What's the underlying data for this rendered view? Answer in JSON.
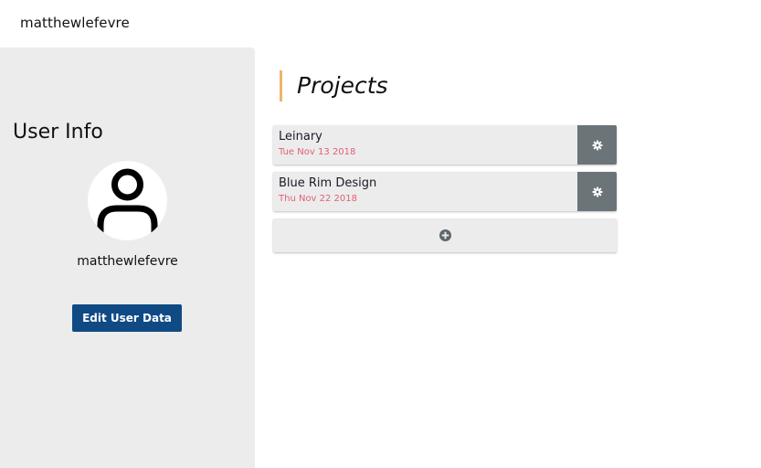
{
  "header": {
    "brand": "matthewlefevre"
  },
  "sidebar": {
    "title": "User Info",
    "avatar_icon": "user-avatar-icon",
    "username": "matthewlefevre",
    "edit_button_label": "Edit User Data"
  },
  "main": {
    "heading": "Projects",
    "projects": [
      {
        "name": "Leinary",
        "date": "Tue Nov 13 2018",
        "action_icon": "gear-icon"
      },
      {
        "name": "Blue Rim Design",
        "date": "Thu Nov 22 2018",
        "action_icon": "gear-icon"
      }
    ],
    "add_icon": "plus-circle-icon"
  },
  "colors": {
    "sidebar_bg": "#ececec",
    "button_primary": "#0f4a85",
    "heading_accent": "#f0b36a",
    "date_text": "#e06076",
    "gear_button_bg": "#6b7479"
  }
}
